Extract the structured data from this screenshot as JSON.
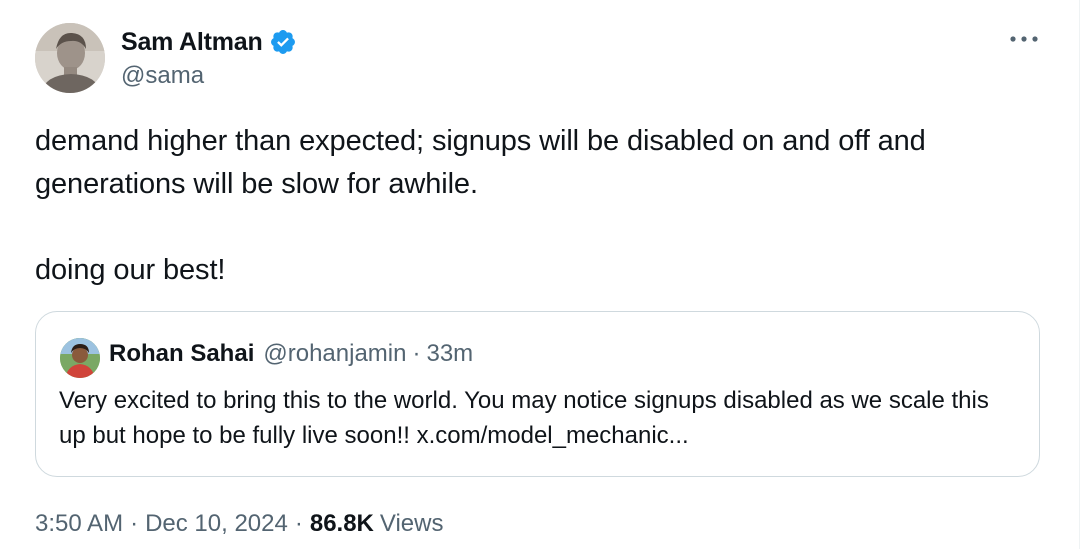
{
  "author": {
    "name": "Sam Altman",
    "handle": "@sama",
    "verified": true,
    "avatar_icon": "user-avatar"
  },
  "more_icon": "more-options-icon",
  "tweet": {
    "text": "demand higher than expected; signups will be disabled on and off and\ngenerations will be slow for awhile.\n\ndoing our best!"
  },
  "quoted_tweet": {
    "author_name": "Rohan Sahai",
    "author_handle": "@rohanjamin",
    "separator": "·",
    "time": "33m",
    "text": "Very excited to bring this to the world. You may notice signups disabled as we scale this up but hope to be fully live soon!! x.com/model_mechanic..."
  },
  "meta": {
    "time": "3:50 AM",
    "separator": "·",
    "date": "Dec 10, 2024",
    "views_count": "86.8K",
    "views_label": "Views"
  },
  "colors": {
    "verified_blue": "#1d9bf0",
    "text_primary": "#0f1419",
    "text_secondary": "#536471",
    "border": "#cfd9de"
  }
}
